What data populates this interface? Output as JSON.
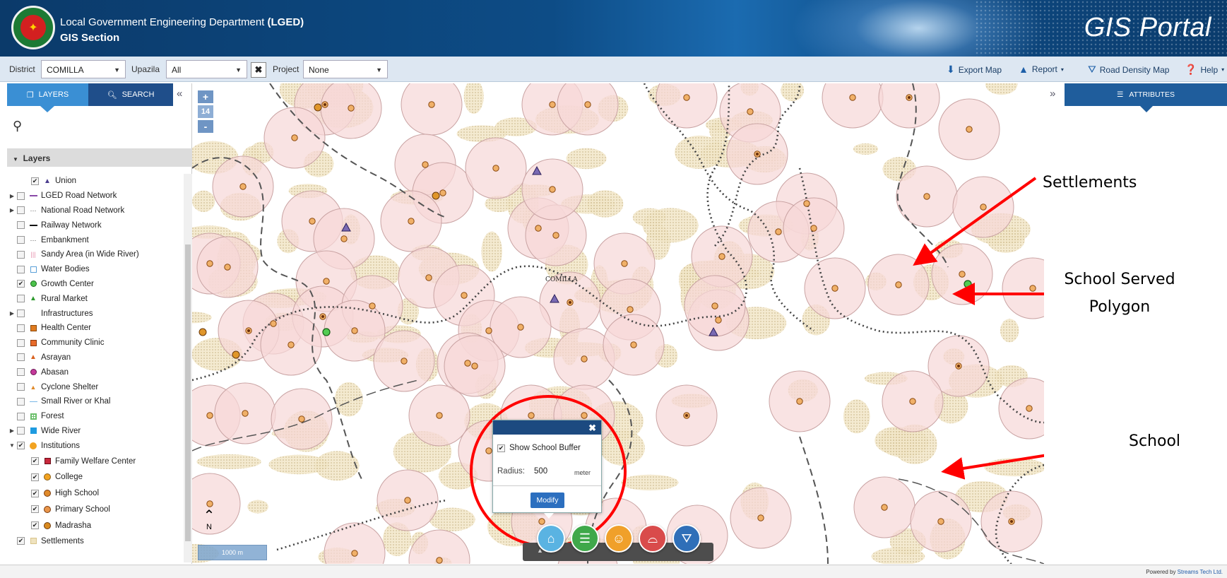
{
  "header": {
    "org_name_prefix": "Local Government Engineering Department ",
    "org_name_abbr": "(LGED)",
    "section": "GIS Section",
    "portal_title": "GIS Portal"
  },
  "toolbar": {
    "district_label": "District",
    "district_value": "COMILLA",
    "upazila_label": "Upazila",
    "upazila_value": "All",
    "project_label": "Project",
    "project_value": "None",
    "export_map": "Export Map",
    "report": "Report",
    "road_density_map": "Road Density Map",
    "help": "Help"
  },
  "left_panel": {
    "tab_layers": "LAYERS",
    "tab_search": "SEARCH",
    "layers_header": "Layers",
    "layers": [
      {
        "label": "Union",
        "checked": true,
        "expandable": false,
        "indent": 1,
        "symbol": "triangle-purple"
      },
      {
        "label": "LGED Road Network",
        "checked": false,
        "expandable": true,
        "indent": 0,
        "symbol": "line-purple"
      },
      {
        "label": "National Road Network",
        "checked": false,
        "expandable": true,
        "indent": 0,
        "symbol": "dotted-line"
      },
      {
        "label": "Railway Network",
        "checked": false,
        "expandable": false,
        "indent": 0,
        "symbol": "line-black"
      },
      {
        "label": "Embankment",
        "checked": false,
        "expandable": false,
        "indent": 0,
        "symbol": "dotted-line"
      },
      {
        "label": "Sandy Area (in Wide River)",
        "checked": false,
        "expandable": false,
        "indent": 0,
        "symbol": "hatch-pink"
      },
      {
        "label": "Water Bodies",
        "checked": false,
        "expandable": false,
        "indent": 0,
        "symbol": "square-blue-outline"
      },
      {
        "label": "Growth Center",
        "checked": true,
        "expandable": false,
        "indent": 0,
        "symbol": "circle-green"
      },
      {
        "label": "Rural Market",
        "checked": false,
        "expandable": false,
        "indent": 0,
        "symbol": "triangle-green"
      },
      {
        "label": "Infrastructures",
        "checked": false,
        "expandable": true,
        "indent": 0,
        "symbol": "none"
      },
      {
        "label": "Health Center",
        "checked": false,
        "expandable": false,
        "indent": 0,
        "symbol": "square-orange"
      },
      {
        "label": "Community Clinic",
        "checked": false,
        "expandable": false,
        "indent": 0,
        "symbol": "square-orange-c"
      },
      {
        "label": "Asrayan",
        "checked": false,
        "expandable": false,
        "indent": 0,
        "symbol": "triangle-orange"
      },
      {
        "label": "Abasan",
        "checked": false,
        "expandable": false,
        "indent": 0,
        "symbol": "circle-magenta"
      },
      {
        "label": "Cyclone Shelter",
        "checked": false,
        "expandable": false,
        "indent": 0,
        "symbol": "triangle-orange-small"
      },
      {
        "label": "Small River or Khal",
        "checked": false,
        "expandable": false,
        "indent": 0,
        "symbol": "line-lightblue"
      },
      {
        "label": "Forest",
        "checked": false,
        "expandable": false,
        "indent": 0,
        "symbol": "grid-green"
      },
      {
        "label": "Wide River",
        "checked": false,
        "expandable": true,
        "indent": 0,
        "symbol": "square-blue"
      },
      {
        "label": "Institutions",
        "checked": true,
        "expandable": true,
        "expanded": true,
        "indent": 0,
        "symbol": "circle-orange"
      },
      {
        "label": "Family Welfare Center",
        "checked": true,
        "expandable": false,
        "indent": 1,
        "symbol": "square-red"
      },
      {
        "label": "College",
        "checked": true,
        "expandable": false,
        "indent": 1,
        "symbol": "circle-orange-c"
      },
      {
        "label": "High School",
        "checked": true,
        "expandable": false,
        "indent": 1,
        "symbol": "circle-orange-h"
      },
      {
        "label": "Primary School",
        "checked": true,
        "expandable": false,
        "indent": 1,
        "symbol": "circle-orange-p"
      },
      {
        "label": "Madrasha",
        "checked": true,
        "expandable": false,
        "indent": 1,
        "symbol": "circle-orange-m"
      },
      {
        "label": "Settlements",
        "checked": true,
        "expandable": false,
        "indent": 0,
        "symbol": "hatch-tan"
      }
    ]
  },
  "map": {
    "zoom_level": "14",
    "place_label": "COMILLA",
    "north_label": "N",
    "scale_label": "1000 m"
  },
  "buffer_popup": {
    "checkbox_label": "Show School Buffer",
    "checked": true,
    "radius_label": "Radius:",
    "radius_value": "500",
    "radius_unit": "meter",
    "modify_label": "Modify"
  },
  "right_panel": {
    "tab_attributes": "ATTRIBUTES"
  },
  "annotations": {
    "settlements": "Settlements",
    "school_served_line1": "School Served",
    "school_served_line2": "Polygon",
    "school": "School"
  },
  "footer": {
    "powered_by": "Powered by ",
    "brand": "Streams Tech Ltd."
  },
  "colors": {
    "header_bg": "#0d4c86",
    "tab_active": "#3a8fd4",
    "buffer_fill": "#f6d9d9",
    "settlement_fill": "#e6d9b8",
    "annotation_red": "#ff0000",
    "school_marker": "#d9822b"
  }
}
